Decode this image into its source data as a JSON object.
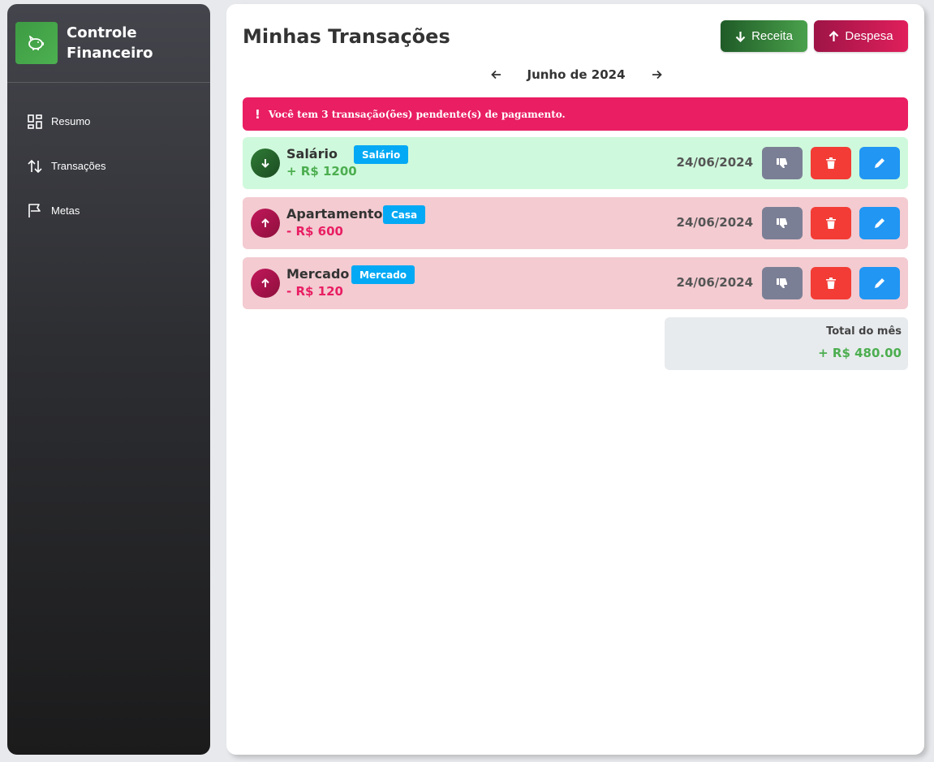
{
  "sidebar": {
    "brand": {
      "title": "Controle Financeiro",
      "icon": "piggy-bank-icon",
      "color": "#4cb050"
    },
    "items": [
      {
        "label": "Resumo",
        "icon": "dashboard-icon"
      },
      {
        "label": "Transações",
        "icon": "swap-vertical-icon"
      },
      {
        "label": "Metas",
        "icon": "flag-icon"
      }
    ]
  },
  "header": {
    "title": "Minhas Transações",
    "receita_label": "Receita",
    "despesa_label": "Despesa"
  },
  "month_nav": {
    "label": "Junho de 2024"
  },
  "alert": {
    "text": "Você tem 3 transação(ões) pendente(s) de pagamento.",
    "color": "#e91e63"
  },
  "transactions": [
    {
      "type": "income",
      "name": "Salário",
      "tag": "Salário",
      "amount": "+ R$ 1200",
      "date": "24/06/2024"
    },
    {
      "type": "expense",
      "name": "Apartamento",
      "tag": "Casa",
      "amount": "- R$ 600",
      "date": "24/06/2024"
    },
    {
      "type": "expense",
      "name": "Mercado",
      "tag": "Mercado",
      "amount": "- R$ 120",
      "date": "24/06/2024"
    }
  ],
  "total": {
    "label": "Total do mês",
    "value": "+ R$ 480.00"
  },
  "colors": {
    "income": "#4cae50",
    "expense": "#e91e63",
    "tag": "#03a9f4",
    "pay_button": "#7b7f95",
    "delete_button": "#f33c35",
    "edit_button": "#2196f3"
  }
}
